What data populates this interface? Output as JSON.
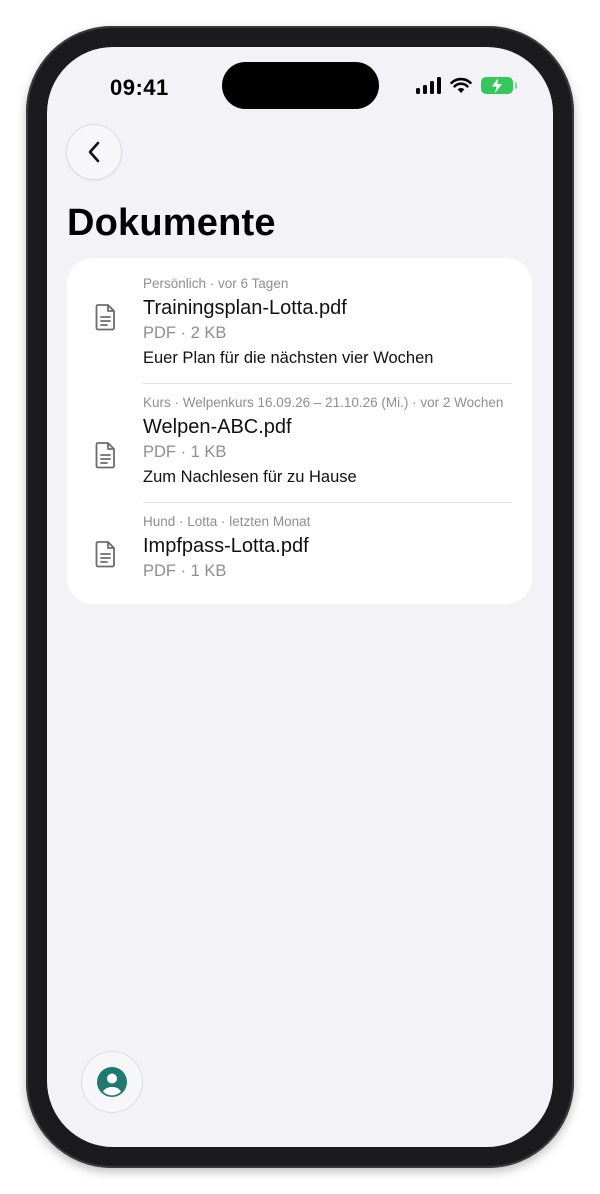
{
  "status_bar": {
    "time": "09:41"
  },
  "header": {
    "title": "Dokumente"
  },
  "documents": [
    {
      "meta": "Persönlich · vor 6 Tagen",
      "name": "Trainingsplan-Lotta.pdf",
      "size": "PDF · 2 KB",
      "description": "Euer Plan für die nächsten vier Wochen"
    },
    {
      "meta": "Kurs · Welpenkurs 16.09.26 – 21.10.26 (Mi.) · vor 2 Wochen",
      "name": "Welpen-ABC.pdf",
      "size": "PDF · 1 KB",
      "description": "Zum Nachlesen für zu Hause"
    },
    {
      "meta": "Hund · Lotta · letzten Monat",
      "name": "Impfpass-Lotta.pdf",
      "size": "PDF · 1 KB",
      "description": ""
    }
  ],
  "icons": {
    "back": "chevron-left-icon",
    "document": "document-icon",
    "profile": "person-circle-icon",
    "wifi": "wifi-icon",
    "signal": "cellular-signal-icon",
    "battery": "battery-charging-icon"
  },
  "colors": {
    "background": "#f2f2f7",
    "card": "#ffffff",
    "secondary_text": "#8e8e93",
    "accent_profile": "#1f7a70",
    "battery": "#34c759"
  }
}
